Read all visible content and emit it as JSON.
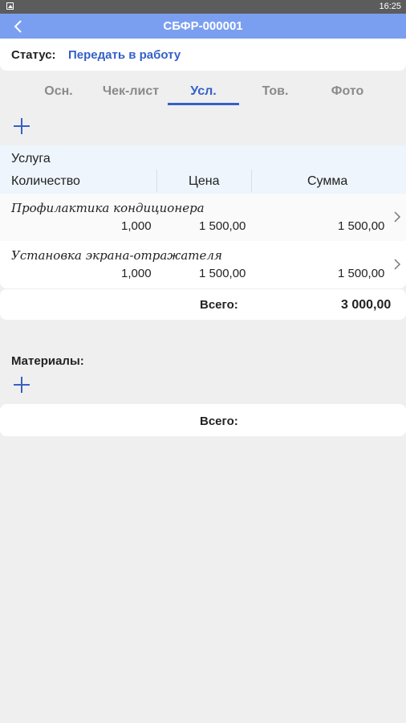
{
  "status_bar": {
    "time": "16:25",
    "notification_icon": "image-icon"
  },
  "app_bar": {
    "title": "СБФР-000001",
    "back_icon": "chevron-left-icon"
  },
  "status": {
    "label": "Статус:",
    "value": "Передать в работу"
  },
  "tabs": [
    {
      "label": "Осн.",
      "active": false
    },
    {
      "label": "Чек-лист",
      "active": false
    },
    {
      "label": "Усл.",
      "active": true
    },
    {
      "label": "Тов.",
      "active": false
    },
    {
      "label": "Фото",
      "active": false
    }
  ],
  "services": {
    "columns": {
      "service": "Услуга",
      "quantity": "Количество",
      "price": "Цена",
      "sum": "Сумма"
    },
    "rows": [
      {
        "name": "Профилактика кондиционера",
        "quantity": "1,000",
        "price": "1 500,00",
        "sum": "1 500,00"
      },
      {
        "name": "Установка экрана-отражателя",
        "quantity": "1,000",
        "price": "1 500,00",
        "sum": "1 500,00"
      }
    ],
    "total_label": "Всего:",
    "total_value": "3 000,00"
  },
  "materials": {
    "title": "Материалы:",
    "total_label": "Всего:"
  },
  "colors": {
    "accent": "#3560c8",
    "app_bar": "#7b9ff0",
    "header_bg": "#eef5fc"
  }
}
